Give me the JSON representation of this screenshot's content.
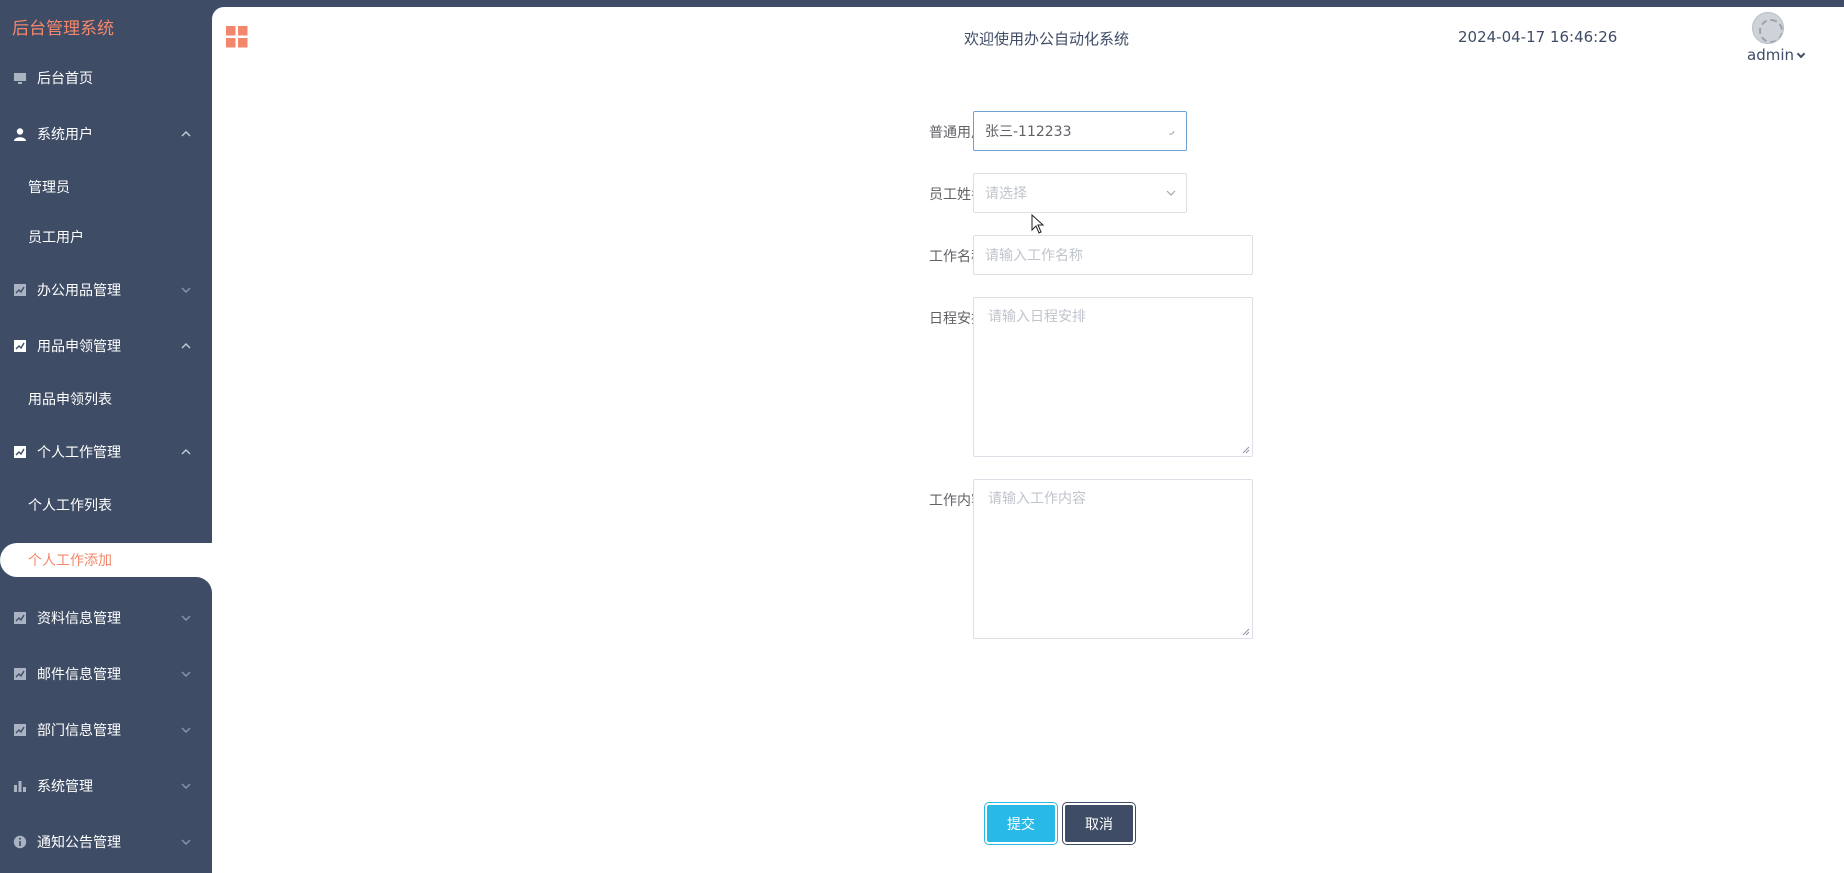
{
  "sidebar": {
    "brand": "后台管理系统",
    "items": [
      {
        "label": "后台首页",
        "icon": "monitor-icon"
      },
      {
        "label": "系统用户",
        "icon": "user-icon",
        "expanded": true
      },
      {
        "label": "管理员",
        "sub": true
      },
      {
        "label": "员工用户",
        "sub": true
      },
      {
        "label": "办公用品管理",
        "icon": "chart-icon",
        "expanded": false
      },
      {
        "label": "用品申领管理",
        "icon": "chart-icon",
        "expanded": true
      },
      {
        "label": "用品申领列表",
        "sub": true
      },
      {
        "label": "个人工作管理",
        "icon": "chart-icon",
        "expanded": true
      },
      {
        "label": "个人工作列表",
        "sub": true
      },
      {
        "label": "个人工作添加",
        "sub": true,
        "active": true
      },
      {
        "label": "资料信息管理",
        "icon": "chart-icon",
        "expanded": false
      },
      {
        "label": "邮件信息管理",
        "icon": "chart-icon",
        "expanded": false
      },
      {
        "label": "部门信息管理",
        "icon": "chart-icon",
        "expanded": false
      },
      {
        "label": "系统管理",
        "icon": "bar-chart-icon",
        "expanded": false
      },
      {
        "label": "通知公告管理",
        "icon": "info-icon",
        "expanded": false
      }
    ]
  },
  "header": {
    "welcome": "欢迎使用办公自动化系统",
    "datetime": "2024-04-17 16:46:26",
    "user": "admin"
  },
  "form": {
    "user_label": "普通用户",
    "user_value": "张三-112233",
    "employee_label": "员工姓名",
    "employee_placeholder": "请选择",
    "work_name_label": "工作名称",
    "work_name_placeholder": "请输入工作名称",
    "schedule_label": "日程安排",
    "schedule_placeholder": "请输入日程安排",
    "content_label": "工作内容",
    "content_placeholder": "请输入工作内容",
    "submit": "提交",
    "cancel": "取消"
  },
  "colors": {
    "sidebar_bg": "#3e4c66",
    "accent": "#f3876b",
    "submit": "#29b9e6"
  }
}
